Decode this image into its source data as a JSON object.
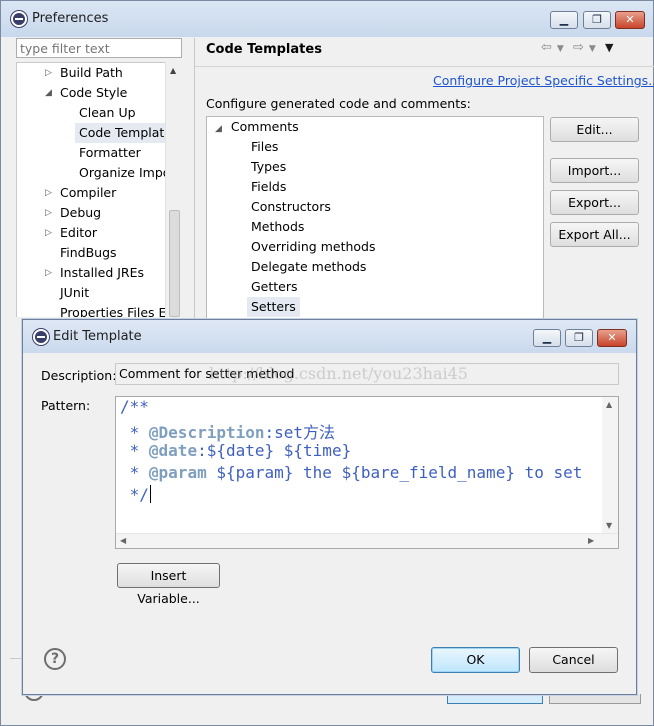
{
  "preferences": {
    "title": "Preferences",
    "filter_placeholder": "type filter text",
    "tree": [
      {
        "label": "Build Path",
        "twisty": "▷"
      },
      {
        "label": "Code Style",
        "twisty": "◢"
      },
      {
        "label": "Clean Up",
        "twisty": ""
      },
      {
        "label": "Code Template",
        "twisty": ""
      },
      {
        "label": "Formatter",
        "twisty": ""
      },
      {
        "label": "Organize Impo",
        "twisty": ""
      },
      {
        "label": "Compiler",
        "twisty": "▷"
      },
      {
        "label": "Debug",
        "twisty": "▷"
      },
      {
        "label": "Editor",
        "twisty": "▷"
      },
      {
        "label": "FindBugs",
        "twisty": ""
      },
      {
        "label": "Installed JREs",
        "twisty": "▷"
      },
      {
        "label": "JUnit",
        "twisty": ""
      },
      {
        "label": "Properties Files Ed",
        "twisty": ""
      }
    ],
    "page_title": "Code Templates",
    "config_link": "Configure Project Specific Settings...",
    "config_desc": "Configure generated code and comments:",
    "templates": {
      "root": "Comments",
      "root_twisty": "◢",
      "children": [
        "Files",
        "Types",
        "Fields",
        "Constructors",
        "Methods",
        "Overriding methods",
        "Delegate methods",
        "Getters",
        "Setters"
      ]
    },
    "buttons": {
      "edit": "Edit...",
      "import": "Import...",
      "export": "Export...",
      "export_all": "Export All..."
    }
  },
  "edit_template": {
    "title": "Edit Template",
    "description_label": "Description:",
    "description_value": "Comment for setter method",
    "pattern_label": "Pattern:",
    "code": {
      "line1": "/**",
      "line2_prefix": " * ",
      "line2_tag": "@Description",
      "line2_rest": ":set方法",
      "line3_prefix": " * ",
      "line3_tag": "@date",
      "line3_rest": ":${date} ${time}",
      "line4_prefix": " * ",
      "line4_tag": "@param",
      "line4_rest": " ${param} the ${bare_field_name} to set",
      "line5": " */"
    },
    "watermark": "http://blog.csdn.net/you23hai45",
    "insert_variable": "Insert Variable...",
    "help": "?",
    "ok": "OK",
    "cancel": "Cancel"
  },
  "colors": {
    "javadoc": "#3f5fbf",
    "javadoc_tag": "#7f9fbf",
    "link": "#1f55cc"
  }
}
